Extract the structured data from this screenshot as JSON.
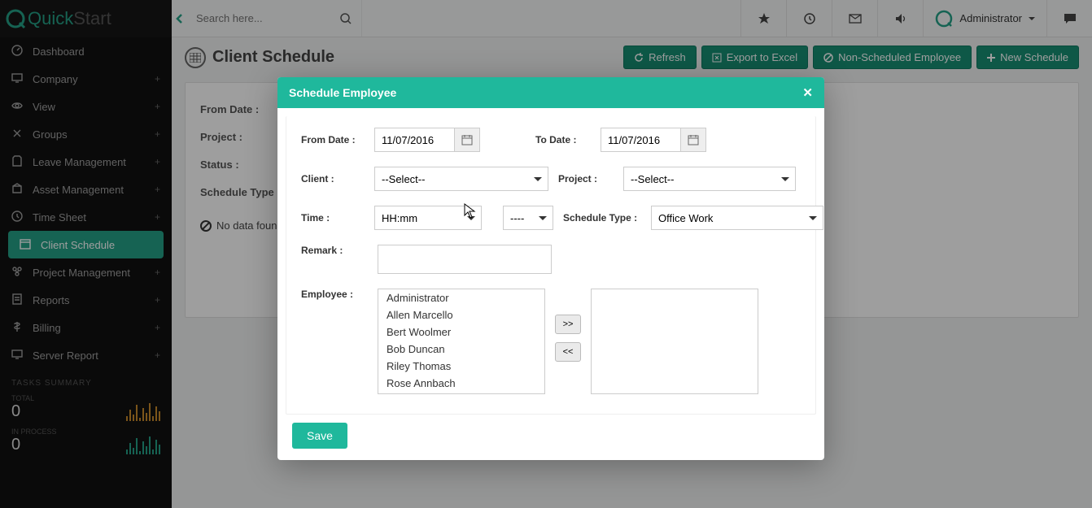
{
  "brand": {
    "name": "QuickStart",
    "prefix": "Quick",
    "suffix": "Start"
  },
  "search_placeholder": "Search here...",
  "user": "Administrator",
  "sidebar": {
    "items": [
      {
        "icon": "dash",
        "label": "Dashboard",
        "plus": false
      },
      {
        "icon": "comp",
        "label": "Company",
        "plus": true
      },
      {
        "icon": "view",
        "label": "View",
        "plus": true
      },
      {
        "icon": "grp",
        "label": "Groups",
        "plus": true
      },
      {
        "icon": "leave",
        "label": "Leave Management",
        "plus": true
      },
      {
        "icon": "asset",
        "label": "Asset Management",
        "plus": true
      },
      {
        "icon": "time",
        "label": "Time Sheet",
        "plus": true
      },
      {
        "icon": "sched",
        "label": "Client Schedule",
        "plus": false,
        "active": true
      },
      {
        "icon": "proj",
        "label": "Project Management",
        "plus": true
      },
      {
        "icon": "rep",
        "label": "Reports",
        "plus": true
      },
      {
        "icon": "bill",
        "label": "Billing",
        "plus": true
      },
      {
        "icon": "srv",
        "label": "Server Report",
        "plus": true
      }
    ],
    "section": "TASKS SUMMARY",
    "total_label": "TOTAL",
    "total_value": "0",
    "inproc_label": "IN PROCESS",
    "inproc_value": "0"
  },
  "page": {
    "title": "Client Schedule",
    "buttons": {
      "refresh": "Refresh",
      "export": "Export to Excel",
      "nonsched": "Non-Scheduled Employee",
      "new": "New Schedule"
    },
    "filters": {
      "from": "From Date :",
      "project": "Project :",
      "status": "Status :",
      "schedtype": "Schedule Type :"
    },
    "nodata": "No data found"
  },
  "modal": {
    "title": "Schedule Employee",
    "labels": {
      "from": "From Date :",
      "to": "To Date :",
      "client": "Client :",
      "project": "Project :",
      "time": "Time :",
      "schedtype": "Schedule Type :",
      "remark": "Remark :",
      "employee": "Employee :"
    },
    "values": {
      "from": "11/07/2016",
      "to": "11/07/2016",
      "client": "--Select--",
      "project": "--Select--",
      "time": "HH:mm",
      "time2": "----",
      "schedtype": "Office Work"
    },
    "employees": [
      "Administrator",
      "Allen Marcello",
      "Bert Woolmer",
      "Bob Duncan",
      "Riley Thomas",
      "Rose Annbach"
    ],
    "move_right": ">>",
    "move_left": "<<",
    "save": "Save"
  }
}
